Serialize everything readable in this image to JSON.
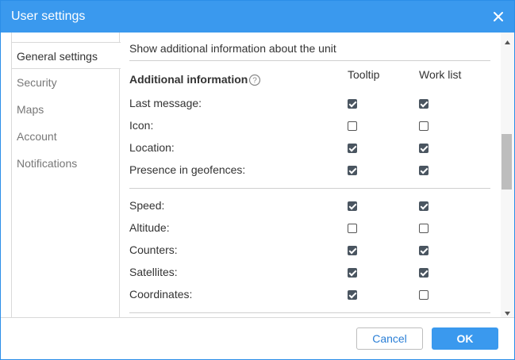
{
  "window": {
    "title": "User settings"
  },
  "sidebar": {
    "items": [
      {
        "label": "General settings",
        "active": true
      },
      {
        "label": "Security"
      },
      {
        "label": "Maps"
      },
      {
        "label": "Account"
      },
      {
        "label": "Notifications"
      }
    ]
  },
  "content": {
    "section_header": "Show additional information about the unit",
    "group_title": "Additional information",
    "columns": {
      "tooltip": "Tooltip",
      "work_list": "Work list"
    },
    "rows": [
      {
        "label": "Last message:",
        "tooltip": true,
        "work_list": true
      },
      {
        "label": "Icon:",
        "tooltip": false,
        "work_list": false
      },
      {
        "label": "Location:",
        "tooltip": true,
        "work_list": true
      },
      {
        "label": "Presence in geofences:",
        "tooltip": true,
        "work_list": true
      },
      {
        "label": "Speed:",
        "tooltip": true,
        "work_list": true
      },
      {
        "label": "Altitude:",
        "tooltip": false,
        "work_list": false
      },
      {
        "label": "Counters:",
        "tooltip": true,
        "work_list": true
      },
      {
        "label": "Satellites:",
        "tooltip": true,
        "work_list": true
      },
      {
        "label": "Coordinates:",
        "tooltip": true,
        "work_list": false
      }
    ]
  },
  "footer": {
    "cancel_label": "Cancel",
    "ok_label": "OK"
  },
  "colors": {
    "accent": "#3a99ee",
    "checkbox_checked": "#4a5560",
    "link_text": "#2b7fd6"
  },
  "icons": {
    "close": "close-icon",
    "help": "help-circle-icon",
    "scroll_up": "chevron-up-icon",
    "scroll_down": "chevron-down-icon"
  }
}
